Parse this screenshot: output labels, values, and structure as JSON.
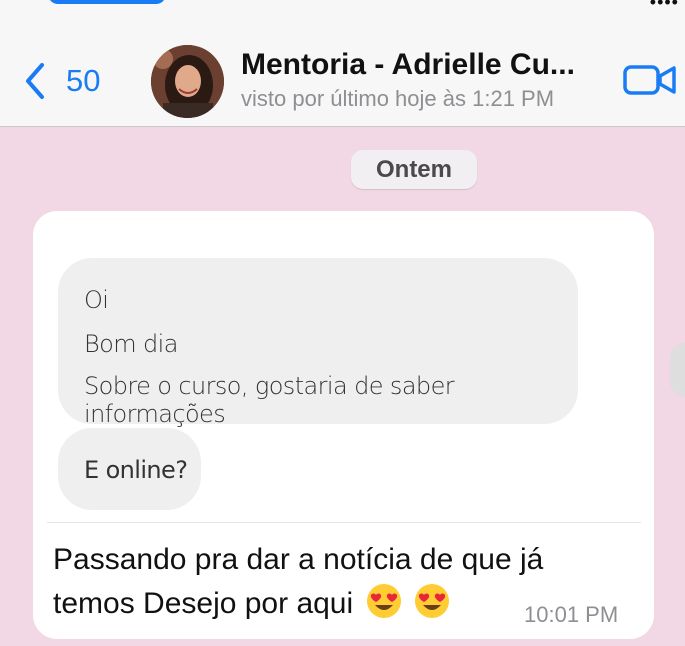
{
  "header": {
    "back_count": "50",
    "title": "Mentoria - Adrielle Cu...",
    "subtitle": "visto por último hoje às 1:21 PM",
    "icons": {
      "back": "chevron-left-icon",
      "video": "video-camera-icon"
    },
    "accent": "#1a7cf5"
  },
  "chat": {
    "date_label": "Ontem",
    "quoted_lines": [
      "Oi",
      "Bom dia",
      "Sobre o curso, gostaria de saber informações"
    ],
    "quoted_second": "E online?",
    "message_text": "Passando pra dar a notícia de que já temos Desejo por aqui",
    "message_emojis": [
      "heart-eyes-emoji",
      "heart-eyes-emoji"
    ],
    "time": "10:01 PM",
    "background": "#f2d8e4"
  }
}
